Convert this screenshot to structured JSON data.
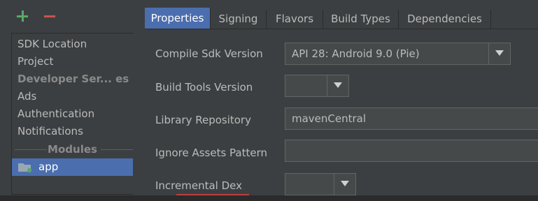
{
  "toolbar": {
    "add_icon": "plus-icon",
    "remove_icon": "minus-icon"
  },
  "sidebar": {
    "items": [
      {
        "label": "SDK Location"
      },
      {
        "label": "Project"
      },
      {
        "label": "Developer Ser... es"
      },
      {
        "label": "Ads"
      },
      {
        "label": "Authentication"
      },
      {
        "label": "Notifications"
      }
    ],
    "modules_header": "Modules",
    "modules": [
      {
        "label": "app",
        "icon": "module-folder-icon"
      }
    ]
  },
  "tabs": [
    {
      "label": "Properties",
      "active": true
    },
    {
      "label": "Signing"
    },
    {
      "label": "Flavors"
    },
    {
      "label": "Build Types"
    },
    {
      "label": "Dependencies"
    }
  ],
  "form": {
    "compile_sdk": {
      "label": "Compile Sdk Version",
      "value": "API 28: Android 9.0 (Pie)"
    },
    "build_tools": {
      "label": "Build Tools Version",
      "value": ""
    },
    "library_repo": {
      "label": "Library Repository",
      "value": "mavenCentral"
    },
    "ignore_assets": {
      "label": "Ignore Assets Pattern",
      "value": ""
    },
    "incremental_dex": {
      "label": "Incremental Dex",
      "value": ""
    }
  },
  "colors": {
    "background": "#3c3f41",
    "selection": "#4b6eaf",
    "add": "#59a869",
    "remove": "#c75450",
    "error_underline": "#bc3f3c"
  }
}
